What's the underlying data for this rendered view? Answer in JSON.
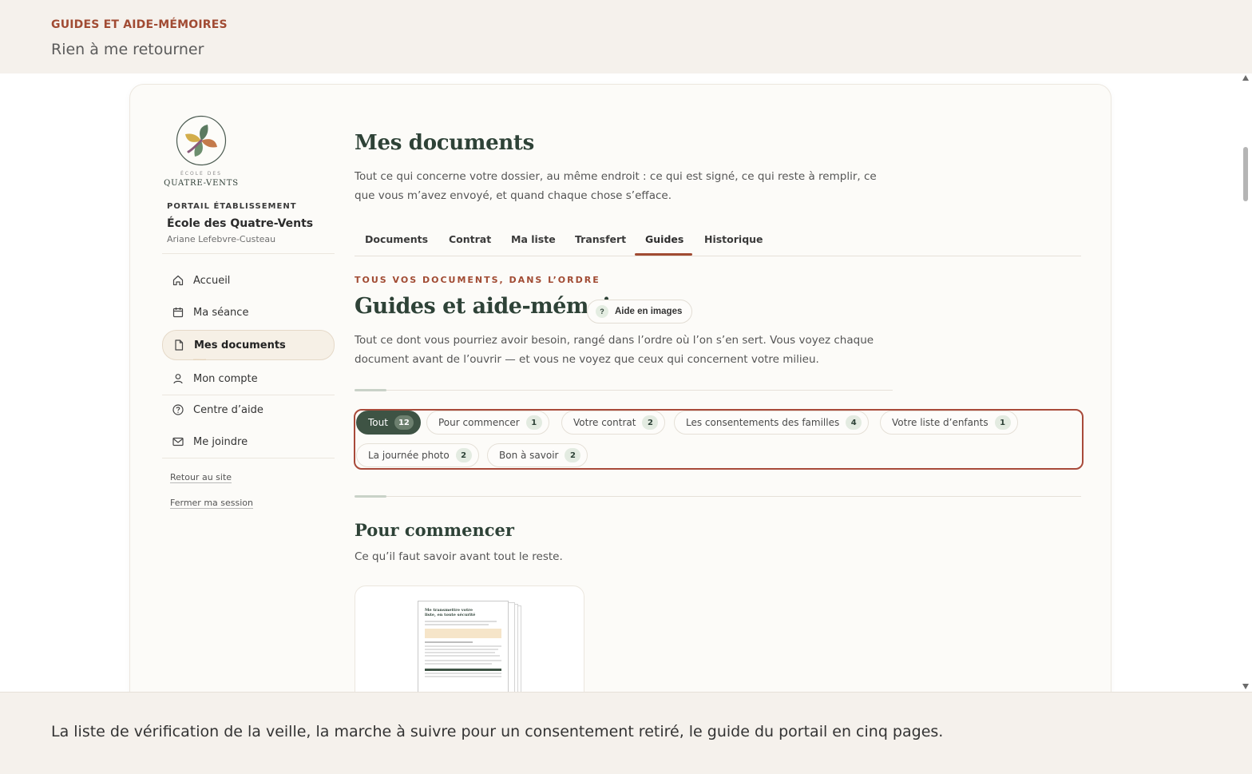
{
  "header": {
    "eyebrow": "GUIDES ET AIDE-MÉMOIRES",
    "subtitle": "Rien à me retourner"
  },
  "sidebar": {
    "logo_small": "ÉCOLE DES",
    "logo_name": "QUATRE-VENTS",
    "portal_label": "PORTAIL ÉTABLISSEMENT",
    "school_name": "École des Quatre-Vents",
    "user_name": "Ariane Lefebvre-Custeau",
    "items": [
      {
        "label": "Accueil",
        "icon": "home-icon"
      },
      {
        "label": "Ma séance",
        "icon": "calendar-icon"
      },
      {
        "label": "Mes documents",
        "icon": "document-icon",
        "active": true
      },
      {
        "label": "Mon compte",
        "icon": "user-icon"
      },
      {
        "label": "Centre d’aide",
        "icon": "help-circle-icon"
      },
      {
        "label": "Me joindre",
        "icon": "mail-icon"
      }
    ],
    "links": [
      "Retour au site",
      "Fermer ma session"
    ]
  },
  "main": {
    "title": "Mes documents",
    "description": "Tout ce qui concerne votre dossier, au même endroit : ce qui est signé, ce qui reste à remplir, ce que vous m’avez envoyé, et quand chaque chose s’efface.",
    "tabs": [
      {
        "label": "Documents"
      },
      {
        "label": "Contrat"
      },
      {
        "label": "Ma liste"
      },
      {
        "label": "Transfert"
      },
      {
        "label": "Guides",
        "active": true
      },
      {
        "label": "Historique"
      }
    ],
    "section": {
      "eyebrow": "TOUS VOS DOCUMENTS, DANS L’ORDRE",
      "title": "Guides et aide-mémoires",
      "help_button": "Aide en images",
      "help_glyph": "?",
      "description": "Tout ce dont vous pourriez avoir besoin, rangé dans l’ordre où l’on s’en sert. Vous voyez chaque document avant de l’ouvrir — et vous ne voyez que ceux qui concernent votre milieu."
    },
    "filters": [
      {
        "label": "Tout",
        "count": "12",
        "active": true
      },
      {
        "label": "Pour commencer",
        "count": "1"
      },
      {
        "label": "Votre contrat",
        "count": "2"
      },
      {
        "label": "Les consentements des familles",
        "count": "4"
      },
      {
        "label": "Votre liste d’enfants",
        "count": "1"
      },
      {
        "label": "La journée photo",
        "count": "2"
      },
      {
        "label": "Bon à savoir",
        "count": "2"
      }
    ],
    "group": {
      "title": "Pour commencer",
      "description": "Ce qu’il faut savoir avant tout le reste.",
      "doc_thumb_title": "Me transmettre votre liste, en toute sécurité"
    }
  },
  "footer": {
    "caption": "La liste de vérification de la veille, la marche à suivre pour un consentement retiré, le guide du portail en cinq pages."
  },
  "colors": {
    "accent": "#a14b33",
    "brand_green": "#2e4237",
    "chip_active": "#3e5344",
    "highlight_border": "#a84a3a"
  }
}
